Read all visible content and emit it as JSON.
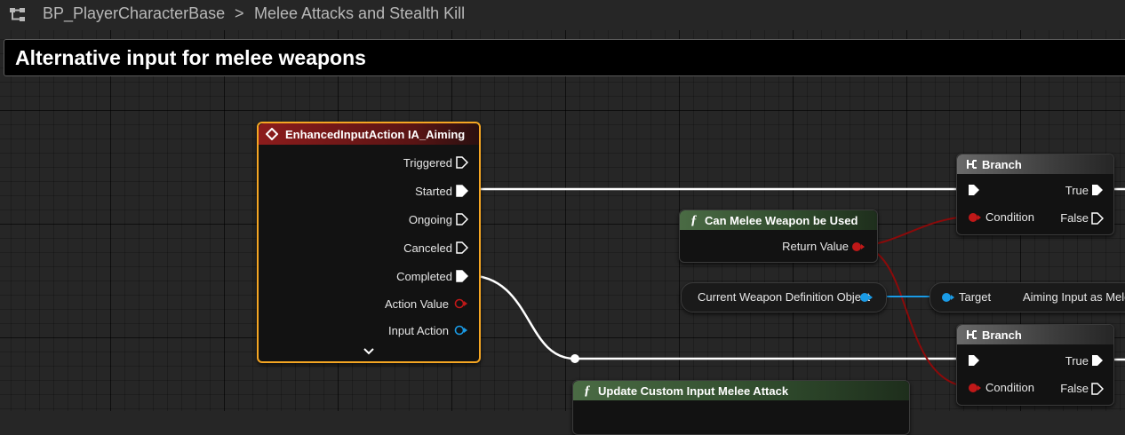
{
  "breadcrumb": {
    "blueprint": "BP_PlayerCharacterBase",
    "separator": ">",
    "graph": "Melee Attacks and Stealth Kill"
  },
  "comment": {
    "title": "Alternative input for melee weapons"
  },
  "event_node": {
    "title": "EnhancedInputAction IA_Aiming",
    "pins": [
      "Triggered",
      "Started",
      "Ongoing",
      "Canceled",
      "Completed",
      "Action Value",
      "Input Action"
    ],
    "expand_icon": "chevron-down-icon"
  },
  "can_melee_node": {
    "title": "Can Melee Weapon be Used",
    "output": "Return Value"
  },
  "current_weapon_node": {
    "label": "Current Weapon Definition Object"
  },
  "aiming_node": {
    "target": "Target",
    "label": "Aiming Input as Melee"
  },
  "branch_top": {
    "title": "Branch",
    "condition": "Condition",
    "true_label": "True",
    "false_label": "False"
  },
  "branch_bottom": {
    "title": "Branch",
    "condition": "Condition",
    "true_label": "True",
    "false_label": "False"
  },
  "update_node": {
    "title": "Update Custom Input Melee Attack"
  },
  "colors": {
    "background": "#262626",
    "selected_outline": "#f5a623",
    "event_header": "#8c1c1c",
    "function_header": "#3d5a3a",
    "branch_header": "#5a5a5a",
    "exec_wire": "#ffffff",
    "bool_wire": "#8b0a0a",
    "object_wire": "#1a9be6"
  }
}
